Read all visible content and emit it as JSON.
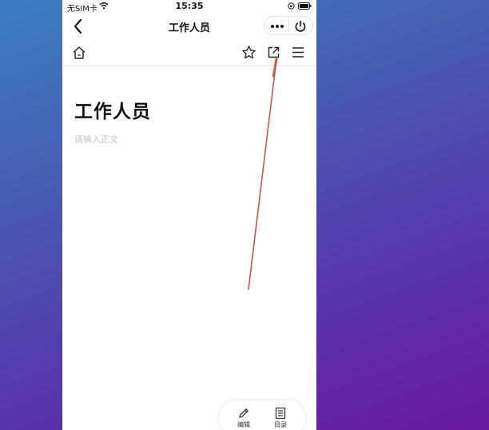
{
  "status_bar": {
    "carrier": "无SIM卡",
    "time": "15:35"
  },
  "nav": {
    "title": "工作人员"
  },
  "document": {
    "title": "工作人员",
    "body_placeholder": "请输入正文"
  },
  "bottom_bar": {
    "edit_label": "编辑",
    "toc_label": "目录"
  },
  "icons": {
    "back": "chevron-left-icon",
    "more": "more-dots-icon",
    "power": "power-icon",
    "home": "home-icon",
    "star": "star-icon",
    "share": "share-icon",
    "menu": "menu-icon",
    "edit": "pencil-icon",
    "toc": "list-icon"
  },
  "colors": {
    "background_top": "#3a7fbf",
    "background_bottom": "#6a1a9c",
    "pointer_line": "#c0392b"
  }
}
